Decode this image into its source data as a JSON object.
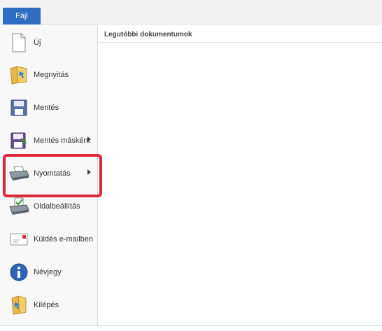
{
  "ribbon": {
    "file_tab": "Fájl"
  },
  "menu": {
    "items": [
      {
        "label": "Új",
        "icon": "new-document-icon"
      },
      {
        "label": "Megnyitás",
        "icon": "open-folder-icon"
      },
      {
        "label": "Mentés",
        "icon": "save-disk-icon"
      },
      {
        "label": "Mentés másként",
        "icon": "save-as-icon",
        "has_submenu": true
      },
      {
        "label": "Nyomtatás",
        "icon": "printer-icon",
        "has_submenu": true,
        "highlighted": true
      },
      {
        "label": "Oldalbeállítás",
        "icon": "page-setup-icon"
      },
      {
        "label": "Küldés e-mailben",
        "icon": "email-icon"
      },
      {
        "label": "Névjegy",
        "icon": "info-icon"
      },
      {
        "label": "Kilépés",
        "icon": "exit-icon"
      }
    ]
  },
  "recent": {
    "title": "Legutóbbi dokumentumok"
  },
  "colors": {
    "file_tab": "#2e6dc1",
    "highlight_box": "#e0263c"
  }
}
